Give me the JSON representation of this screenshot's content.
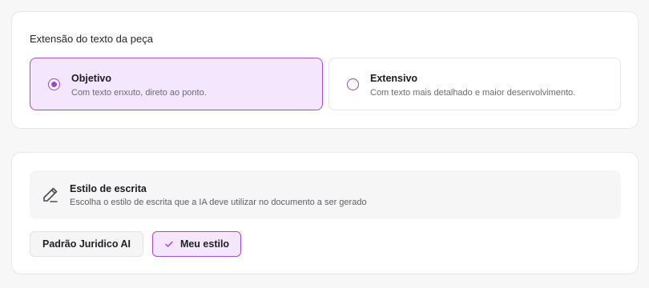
{
  "length_section": {
    "title": "Extensão do texto da peça",
    "options": [
      {
        "title": "Objetivo",
        "description": "Com texto enxuto, direto ao ponto.",
        "selected": true
      },
      {
        "title": "Extensivo",
        "description": "Com texto mais detalhado e maior desenvolvimento.",
        "selected": false
      }
    ]
  },
  "style_section": {
    "icon": "pencil-icon",
    "title": "Estilo de escrita",
    "description": "Escolha o estilo de escrita que a IA deve utilizar no documento a ser gerado",
    "buttons": [
      {
        "label": "Padrão Juridico AI",
        "selected": false
      },
      {
        "label": "Meu estilo",
        "selected": true,
        "icon": "check-icon"
      }
    ]
  },
  "colors": {
    "accent": "#9b45d9",
    "selected_background": "#f3e6fd",
    "card_background": "#ffffff",
    "page_background": "#f7f7f8"
  }
}
